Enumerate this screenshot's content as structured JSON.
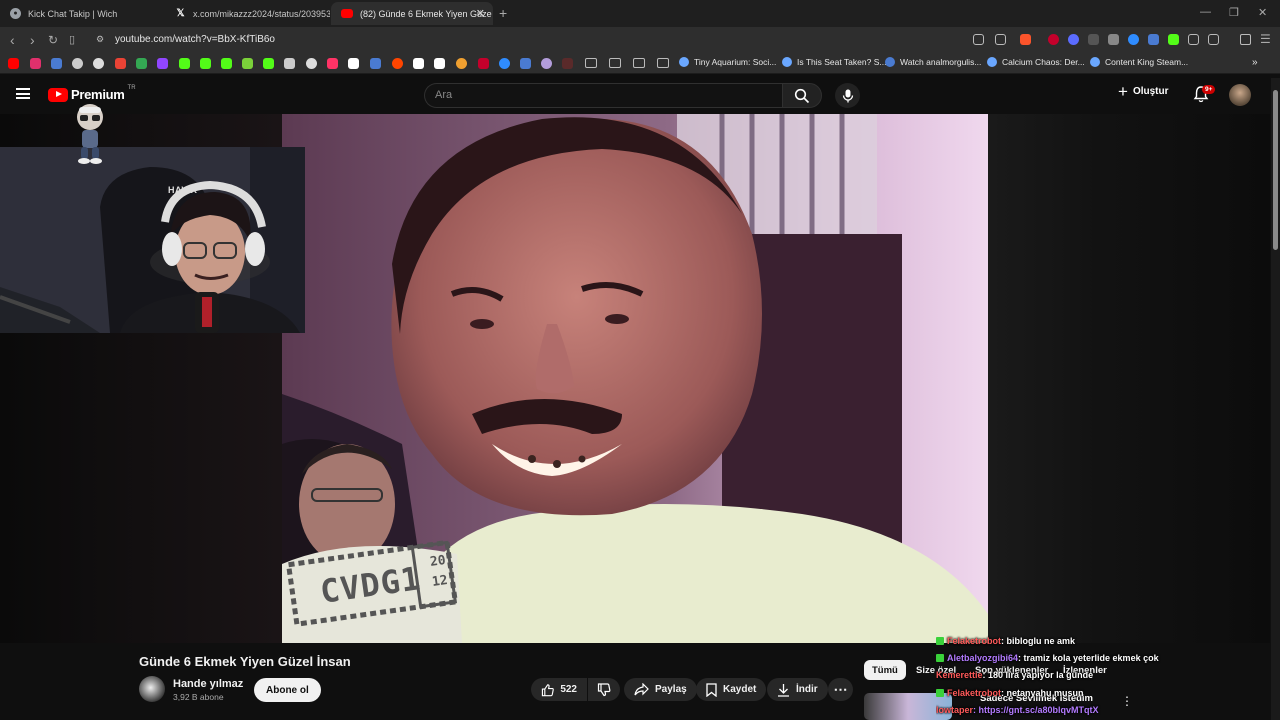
{
  "browser": {
    "tabs": [
      {
        "title": "Kick Chat Takip | Wich",
        "favicon": "globe-icon",
        "active": false
      },
      {
        "title": "x.com/mikazzz2024/status/2039539",
        "favicon": "x-icon",
        "active": false
      },
      {
        "title": "(82) Günde 6 Ekmek Yiyen Güze",
        "favicon": "youtube-icon",
        "active": true
      }
    ],
    "url": "youtube.com/watch?v=BbX-KfTiB6o",
    "bookmarks": [
      {
        "label": "Tiny Aquarium: Soci..."
      },
      {
        "label": "Is This Seat Taken? S..."
      },
      {
        "label": "Watch analmorgulis..."
      },
      {
        "label": "Calcium Chaos: Der..."
      },
      {
        "label": "Content King Steam..."
      }
    ]
  },
  "youtube": {
    "logo_text": "Premium",
    "region": "TR",
    "search_placeholder": "Ara",
    "create_label": "Oluştur",
    "notifications_badge": "9+"
  },
  "video": {
    "watermark_text": "CVDG1",
    "watermark_year_top": "20",
    "watermark_year_bottom": "12",
    "webcam_chair_label": "HAWK"
  },
  "video_info": {
    "title": "Günde 6 Ekmek Yiyen Güzel İnsan",
    "channel_name": "Hande yılmaz",
    "subscribers": "3,92 B abone",
    "subscribe_label": "Abone ol",
    "like_count": "522",
    "share_label": "Paylaş",
    "save_label": "Kaydet",
    "download_label": "İndir"
  },
  "related_chips": [
    {
      "label": "Tümü",
      "selected": true
    },
    {
      "label": "Size özel",
      "selected": false
    },
    {
      "label": "Son yüklenenler",
      "selected": false
    },
    {
      "label": "İzlenenler",
      "selected": false
    }
  ],
  "chat_overlay": [
    {
      "user": "Felaketrobot",
      "text": ": bibloglu ne amk"
    },
    {
      "user": "Aletbalyozgibi64",
      "text": ": tramiz kola yeterlide ekmek çok"
    },
    {
      "user": "Kemerettie",
      "text": ": 180 lira yapıyor la günde"
    },
    {
      "user": "Felaketrobot",
      "text": ": netanyahu musun"
    },
    {
      "user": "lowtaper",
      "text": ": https://gnt.sc/a80blqvMTqtX"
    }
  ],
  "related_video": {
    "title": "Sadece Sevilmek İstedim"
  },
  "colors": {
    "brand_red": "#ff0000",
    "background": "#0f0f0f",
    "chat_username": "#b37bff"
  }
}
